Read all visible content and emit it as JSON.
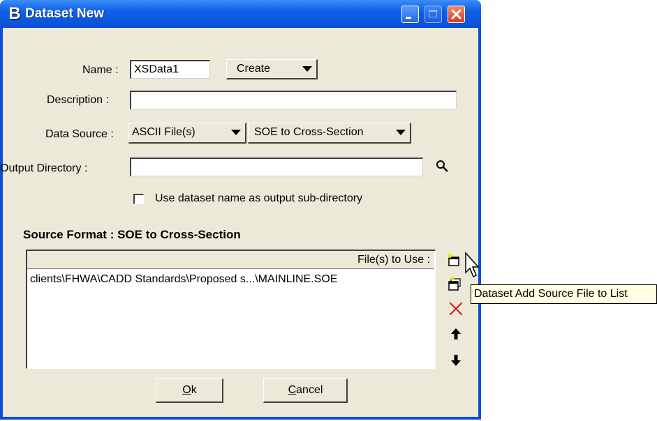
{
  "window": {
    "title": "Dataset New",
    "app_icon": "B"
  },
  "form": {
    "name_label": "Name :",
    "name_value": "XSData1",
    "create_button": "Create",
    "description_label": "Description :",
    "description_value": "",
    "data_source_label": "Data Source :",
    "data_source_value": "ASCII File(s)",
    "data_source_format": "SOE to Cross-Section",
    "output_directory_label": "Output Directory :",
    "output_directory_value": "",
    "use_dataset_name_label": "Use dataset name as output sub-directory",
    "use_dataset_name_checked": false
  },
  "source_format": {
    "title": "Source Format : SOE to Cross-Section",
    "files_header": "File(s) to Use :",
    "files": [
      "clients\\FHWA\\CADD Standards\\Proposed s...\\MAINLINE.SOE"
    ]
  },
  "side_toolbar": {
    "icons": [
      "add-file-icon",
      "add-folder-icon",
      "delete-icon",
      "move-up-icon",
      "move-down-icon"
    ]
  },
  "buttons": {
    "ok_accel": "O",
    "ok_rest": "k",
    "cancel_accel": "C",
    "cancel_rest": "ancel"
  },
  "tooltip": {
    "text": "Dataset Add Source File to List"
  },
  "colors": {
    "titlebar": "#0a4fd6",
    "dialog_bg": "#ece9d8",
    "close_button": "#d0401c",
    "tooltip_bg": "#ffffe1",
    "delete_icon": "#d22020"
  }
}
